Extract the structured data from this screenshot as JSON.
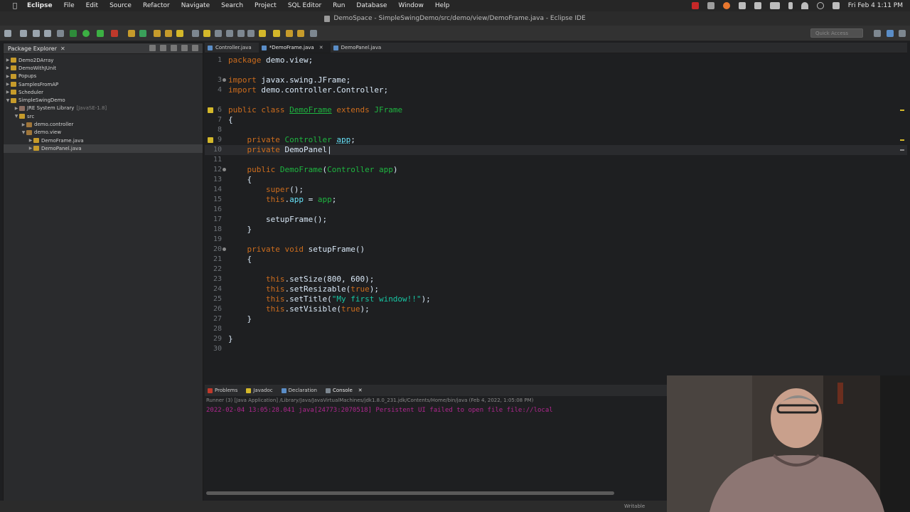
{
  "menubar": {
    "app_name": "Eclipse",
    "items": [
      "File",
      "Edit",
      "Source",
      "Refactor",
      "Navigate",
      "Search",
      "Project",
      "SQL Editor",
      "Run",
      "Database",
      "Window",
      "Help"
    ],
    "clock": "Fri Feb 4  1:11 PM"
  },
  "window": {
    "title": "DemoSpace - SimpleSwingDemo/src/demo/view/DemoFrame.java - Eclipse IDE"
  },
  "toolbar": {
    "quick_access_placeholder": "Quick Access"
  },
  "explorer": {
    "tab_label": "Package Explorer",
    "items": [
      {
        "label": "Demo2DArray",
        "extra": ""
      },
      {
        "label": "DemoWithJUnit",
        "extra": ""
      },
      {
        "label": "Popups",
        "extra": ""
      },
      {
        "label": "SamplesFromAP",
        "extra": ""
      },
      {
        "label": "Scheduler",
        "extra": ""
      },
      {
        "label": "SimpleSwingDemo",
        "extra": ""
      },
      {
        "label": "JRE System Library",
        "extra": "[JavaSE-1.8]"
      },
      {
        "label": "src",
        "extra": ""
      },
      {
        "label": "demo.controller",
        "extra": ""
      },
      {
        "label": "demo.view",
        "extra": ""
      },
      {
        "label": "DemoFrame.java",
        "extra": ""
      },
      {
        "label": "DemoPanel.java",
        "extra": ""
      }
    ]
  },
  "editor": {
    "tabs": [
      "Controller.java",
      "*DemoFrame.java",
      "DemoPanel.java"
    ],
    "line_numbers": [
      "1",
      "3",
      "4",
      "6",
      "7",
      "8",
      "9",
      "10",
      "11",
      "12",
      "13",
      "14",
      "15",
      "16",
      "17",
      "18",
      "19",
      "20",
      "21",
      "22",
      "23",
      "24",
      "25",
      "26",
      "27",
      "28",
      "29",
      "30"
    ]
  },
  "console": {
    "tabs": [
      "Problems",
      "Javadoc",
      "Declaration",
      "Console"
    ],
    "description": "Runner (3) [Java Application] /Library/Java/JavaVirtualMachines/jdk1.8.0_231.jdk/Contents/Home/bin/java  (Feb 4, 2022, 1:05:08 PM)",
    "output": "2022-02-04 13:05:28.041 java[24773:2070518] Persistent UI failed to open file file://local"
  },
  "statusbar": {
    "mode": "Writable"
  },
  "colors": {
    "keyword": "#cc6c1d",
    "type": "#1eb540",
    "field": "#66e1f8",
    "string": "#17c6a3",
    "error_output": "#b0278f"
  }
}
